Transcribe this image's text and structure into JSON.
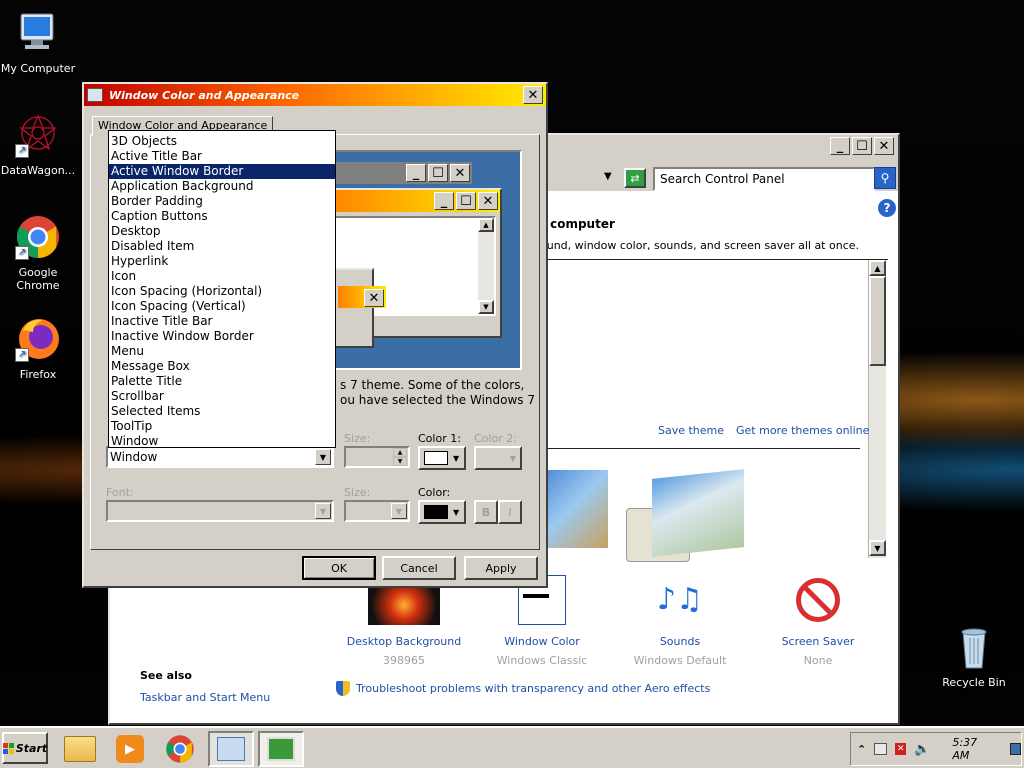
{
  "desktop": {
    "icons": [
      {
        "label": "My Computer"
      },
      {
        "label": "DataWagon..."
      },
      {
        "label": "Google Chrome"
      },
      {
        "label": "Firefox"
      },
      {
        "label": "Recycle Bin"
      }
    ]
  },
  "control_panel": {
    "search_placeholder": "Search Control Panel",
    "heading_fragment": "r computer",
    "subtitle_fragment": "ound, window color, sounds, and screen saver all at once.",
    "theme_links": {
      "save": "Save theme",
      "get_more": "Get more themes online"
    },
    "items": [
      {
        "title": "Desktop Background",
        "subtitle": "398965"
      },
      {
        "title": "Window Color",
        "subtitle": "Windows Classic"
      },
      {
        "title": "Sounds",
        "subtitle": "Windows Default"
      },
      {
        "title": "Screen Saver",
        "subtitle": "None"
      }
    ],
    "see_also": {
      "heading": "See also",
      "link": "Taskbar and Start Menu"
    },
    "troubleshoot_link": "Troubleshoot problems with transparency and other Aero effects"
  },
  "dialog": {
    "title": "Window Color and Appearance",
    "tab": "Window Color and Appearance",
    "desc_line1": "s 7 theme.  Some of the colors,",
    "desc_line2": "ou have selected the Windows 7",
    "item_label_size": "Size:",
    "color1": "Color 1:",
    "color2": "Color 2:",
    "item_selected": "Window",
    "font_label": "Font:",
    "font_size_label": "Size:",
    "font_color_label": "Color:",
    "bold": "B",
    "italic": "I",
    "ok": "OK",
    "cancel": "Cancel",
    "apply": "Apply",
    "dropdown_options": [
      "3D Objects",
      "Active Title Bar",
      "Active Window Border",
      "Application Background",
      "Border Padding",
      "Caption Buttons",
      "Desktop",
      "Disabled Item",
      "Hyperlink",
      "Icon",
      "Icon Spacing (Horizontal)",
      "Icon Spacing (Vertical)",
      "Inactive Title Bar",
      "Inactive Window Border",
      "Menu",
      "Message Box",
      "Palette Title",
      "Scrollbar",
      "Selected Items",
      "ToolTip",
      "Window"
    ],
    "highlighted_option": "Active Window Border",
    "colors": {
      "title_start": "#c00000",
      "title_end": "#ffee00",
      "selection": "#0a246a",
      "preview_bg": "#3a6ea5"
    }
  },
  "taskbar": {
    "start": "Start",
    "clock": "5:37 AM"
  }
}
